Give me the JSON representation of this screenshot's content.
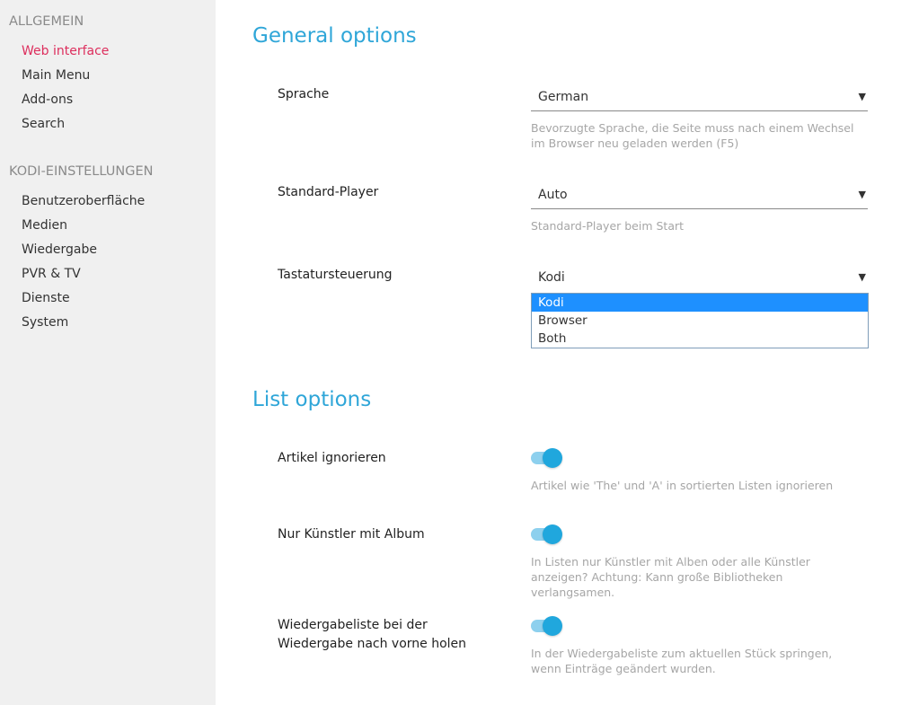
{
  "sidebar": {
    "section1_title": "ALLGEMEIN",
    "section1_items": [
      "Web interface",
      "Main Menu",
      "Add-ons",
      "Search"
    ],
    "section2_title": "KODI-EINSTELLUNGEN",
    "section2_items": [
      "Benutzeroberfläche",
      "Medien",
      "Wiedergabe",
      "PVR & TV",
      "Dienste",
      "System"
    ]
  },
  "general": {
    "title": "General options",
    "language": {
      "label": "Sprache",
      "value": "German",
      "hint": "Bevorzugte Sprache, die Seite muss nach einem Wechsel im Browser neu geladen werden (F5)"
    },
    "player": {
      "label": "Standard-Player",
      "value": "Auto",
      "hint": "Standard-Player beim Start"
    },
    "keyboard": {
      "label": "Tastatursteuerung",
      "value": "Kodi",
      "options": [
        "Kodi",
        "Browser",
        "Both"
      ]
    }
  },
  "list": {
    "title": "List options",
    "ignore_articles": {
      "label": "Artikel ignorieren",
      "hint": "Artikel wie 'The' und 'A' in sortierten Listen ignorieren",
      "on": true
    },
    "album_artists": {
      "label": "Nur Künstler mit Album",
      "hint": "In Listen nur Künstler mit Alben oder alle Künstler anzeigen? Achtung: Kann große Bibliotheken verlangsamen.",
      "on": true
    },
    "focus_playlist": {
      "label": "Wiedergabeliste bei der Wiedergabe nach vorne holen",
      "hint": "In der Wiedergabeliste zum aktuellen Stück springen, wenn Einträge geändert wurden.",
      "on": true
    }
  },
  "colors": {
    "accent": "#2fa6d8",
    "active_nav": "#dd2e5d",
    "toggle_on": "#20a7dd",
    "dropdown_selected": "#1e90ff"
  }
}
